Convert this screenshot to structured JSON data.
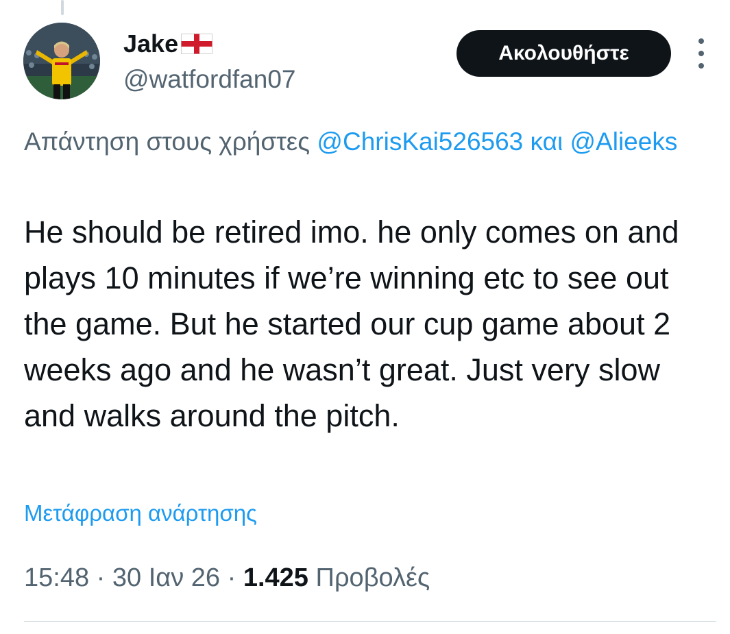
{
  "user": {
    "display_name": "Jake",
    "flag_icon": "england-flag-icon",
    "handle": "@watfordfan07",
    "avatar_icon": "profile-photo"
  },
  "follow_button": {
    "label": "Ακολουθήστε"
  },
  "more_menu": {
    "icon": "more-vertical-icon"
  },
  "reply_context": {
    "prefix": "Απάντηση στους χρήστες",
    "mention_1": "@ChrisKai526563",
    "conjunction": "και",
    "mention_2": "@Alieeks"
  },
  "tweet": {
    "text": "He should be retired imo. he only comes on and plays 10 minutes if we’re winning etc to see out the game. But he started our cup game about 2 weeks ago and he wasn’t great. Just very slow and walks around the pitch."
  },
  "translate_link": "Μετάφραση ανάρτησης",
  "meta": {
    "time": "15:48",
    "separator": "·",
    "date": "30 Ιαν 26",
    "views_count": "1.425",
    "views_label": "Προβολές"
  },
  "colors": {
    "text_primary": "#0f1419",
    "text_secondary": "#536471",
    "link": "#1d9bf0",
    "button_bg": "#0f1419",
    "divider": "#cfd9de"
  }
}
